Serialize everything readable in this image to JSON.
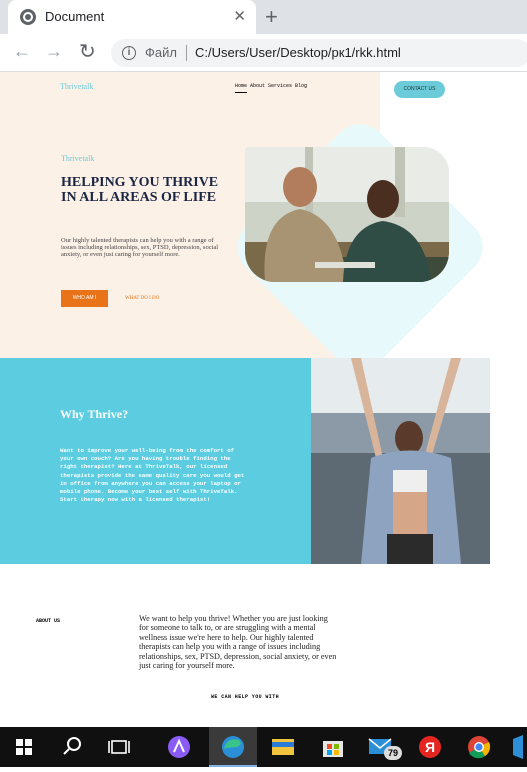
{
  "browser": {
    "tab_title": "Document",
    "close_glyph": "✕",
    "newtab_glyph": "+",
    "back_glyph": "←",
    "forward_glyph": "→",
    "reload_glyph": "↻",
    "info_glyph": "i",
    "scheme_label": "Файл",
    "url": "C:/Users/User/Desktop/рк1/rkk.html"
  },
  "header": {
    "brand": "Thrivetalk",
    "nav": [
      "Home",
      "About",
      "Services",
      "Blog"
    ],
    "contact_button": "CONTACT US"
  },
  "hero": {
    "brand": "Thrivetalk",
    "title": "HELPING YOU THRIVE IN ALL AREAS OF LIFE",
    "text": "Our highly talented therapists can help you with a range of issues including relationships, sex, PTSD, depression, social anxiety, or even just caring for yourself more.",
    "primary_button": "WHO AM I",
    "secondary_link": "WHAT DO I DO"
  },
  "why": {
    "title": "Why Thrive?",
    "text": "Want to improve your well-being from the comfort of your own couch? Are you having trouble finding the right therapist? Here at ThriveTalk, our licensed therapists provide the same quality care you would get in office from anywhere you can access your laptop or mobile phone. Become your best self with ThriveTalk. Start therapy now with a licensed therapist!"
  },
  "about": {
    "label": "ABOUT US",
    "text": "We want to help you thrive! Whether you are just looking for someone to talk to, or are struggling with a mental wellness issue we're here to help. Our highly talented therapists can help you with a range of issues including relationships, sex, PTSD, depression, social anxiety, or even just caring for yourself more.",
    "help_label": "WE CAN HELP YOU WITH"
  },
  "taskbar": {
    "mail_badge": "79",
    "yandex_letter": "Я",
    "items": [
      "windows-start-icon",
      "search-icon",
      "task-view-icon",
      "alice-icon",
      "edge-icon",
      "file-explorer-icon",
      "store-icon",
      "mail-icon",
      "yandex-browser-icon",
      "chrome-icon",
      "vscode-icon"
    ]
  },
  "colors": {
    "accent_teal": "#5ccde0",
    "accent_orange": "#e97318",
    "hero_bg": "#fcf1e6",
    "title_navy": "#1c2544"
  }
}
